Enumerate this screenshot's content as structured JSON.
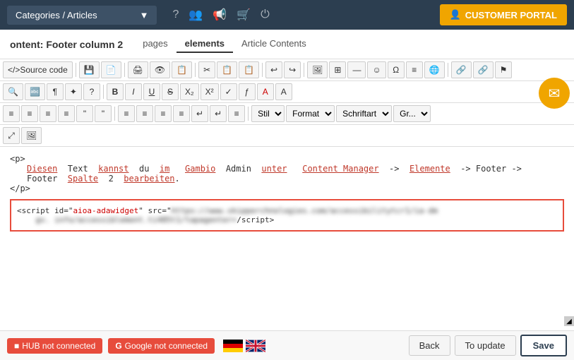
{
  "nav": {
    "dropdown_label": "Categories / Articles",
    "customer_portal_label": "CUSTOMER PORTAL"
  },
  "header": {
    "content_title": "ontent: Footer column 2",
    "tabs": [
      {
        "label": "pages",
        "active": false
      },
      {
        "label": "elements",
        "active": true
      },
      {
        "label": "Article Contents",
        "active": false
      }
    ]
  },
  "toolbar": {
    "row1": {
      "source_code": "Source code",
      "buttons": [
        "💾",
        "📄",
        "🔲",
        "🔲",
        "🔲",
        "✂️",
        "📋",
        "📋",
        "↩",
        "↪",
        "🖼",
        "⊞",
        "—",
        "☺",
        "Ω",
        "≡",
        "🌐",
        "🔗",
        "🔗",
        "⚑"
      ]
    },
    "row2": {
      "buttons": [
        "🔍",
        "🔤",
        "¶",
        "✦",
        "?",
        "B",
        "I",
        "U",
        "S",
        "X₂",
        "X²",
        "✓",
        "ƒ",
        "A",
        "A"
      ]
    },
    "row3": {
      "buttons": [
        "≡",
        "≡",
        "≡",
        "≡",
        "\"",
        "\"",
        "≡",
        "≡",
        "≡",
        "≡",
        "↵",
        "↵",
        "≡"
      ],
      "selects": [
        "Stil",
        "Format",
        "Schriftart",
        "Gr..."
      ]
    },
    "row4": {
      "buttons": [
        "⤢",
        "🖼"
      ]
    }
  },
  "code_content": {
    "paragraph_open": "<p>",
    "indent_text": "Diesen Text kannst du im Gambio Admin unter Content Manager -&gt; Elemente -&gt; Footer -&gt; Footer Spalte 2 bearbeiten.",
    "link_words": [
      "Diesen",
      "Text",
      "kannst",
      "du",
      "im",
      "Gambio",
      "Admin",
      "unter",
      "Content Manager",
      "-&gt;",
      "Elemente",
      "-&gt;",
      "Footer -&gt;"
    ],
    "paragraph_close": "</p>",
    "script_tag": "<script id=\"aioa-adawidget\" src=\"",
    "script_src_blurred": "https://www.skipperchnologies.com/accessibilitytcr1/-ia-dm",
    "script_mid_blurred": "gv. info/accessiblement.ti485t1/tapagenter=",
    "script_close": "/script>"
  },
  "status": {
    "hub_label": "HUB not connected",
    "google_label": "Google not connected",
    "hub_icon": "■",
    "google_icon": "G"
  },
  "actions": {
    "back_label": "Back",
    "to_update_label": "To update",
    "save_label": "Save"
  }
}
